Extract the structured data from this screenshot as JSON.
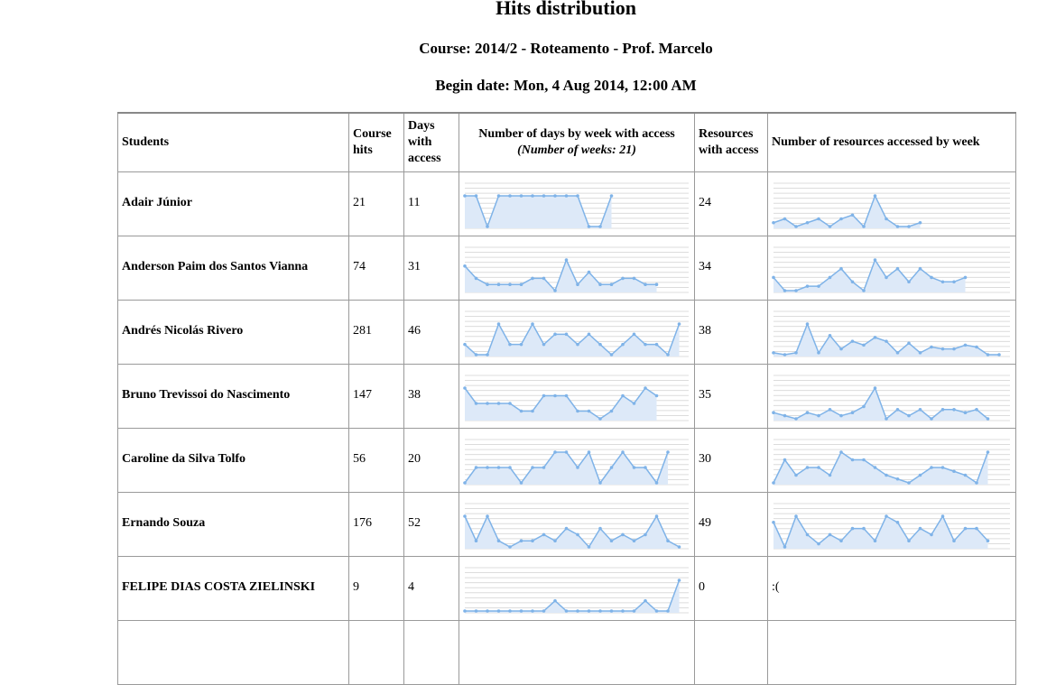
{
  "report": {
    "title": "Hits distribution",
    "course": "Course: 2014/2 - Roteamento - Prof. Marcelo",
    "begin_date": "Begin date: Mon, 4 Aug 2014, 12:00 AM"
  },
  "table": {
    "headers": {
      "students": "Students",
      "course_hits": "Course hits",
      "days_with_access": "Days with access",
      "days_by_week": "Number of days by week with access",
      "weeks_note": "(Number of weeks: 21)",
      "resources_with_access": "Resources with access",
      "resources_by_week": "Number of resources accessed by week"
    },
    "rows": [
      {
        "name": "Adair Júnior",
        "hits": "21",
        "days": "11",
        "days_week": [
          1,
          1,
          0,
          1,
          1,
          1,
          1,
          1,
          1,
          1,
          1,
          0,
          0,
          1
        ],
        "resources": "24",
        "res_week": [
          1,
          2,
          0,
          1,
          2,
          0,
          2,
          3,
          0,
          8,
          2,
          0,
          0,
          1
        ],
        "res_text": ""
      },
      {
        "name": "Anderson Paim dos Santos Vianna",
        "hits": "74",
        "days": "31",
        "days_week": [
          3,
          1,
          0,
          0,
          0,
          0,
          1,
          1,
          -1,
          4,
          0,
          2,
          0,
          0,
          1,
          1,
          0,
          0
        ],
        "resources": "34",
        "res_week": [
          3,
          0,
          0,
          1,
          1,
          3,
          5,
          2,
          0,
          7,
          3,
          5,
          2,
          5,
          3,
          2,
          2,
          3
        ],
        "res_text": ""
      },
      {
        "name": "Andrés Nicolás Rivero",
        "hits": "281",
        "days": "46",
        "days_week": [
          1,
          0,
          0,
          3,
          1,
          1,
          3,
          1,
          2,
          2,
          1,
          2,
          1,
          0,
          1,
          2,
          1,
          1,
          0,
          3
        ],
        "resources": "38",
        "res_week": [
          1,
          0,
          1,
          16,
          1,
          10,
          3,
          7,
          5,
          9,
          7,
          1,
          6,
          1,
          4,
          3,
          3,
          5,
          4,
          0,
          0
        ],
        "res_text": ""
      },
      {
        "name": "Bruno Trevissoi do Nascimento",
        "hits": "147",
        "days": "38",
        "days_week": [
          3,
          1,
          1,
          1,
          1,
          0,
          0,
          2,
          2,
          2,
          0,
          0,
          -1,
          0,
          2,
          1,
          3,
          2
        ],
        "resources": "35",
        "res_week": [
          2,
          1,
          0,
          2,
          1,
          3,
          1,
          2,
          4,
          10,
          0,
          3,
          1,
          3,
          0,
          3,
          3,
          2,
          3,
          0
        ],
        "res_text": ""
      },
      {
        "name": "Caroline da Silva Tolfo",
        "hits": "56",
        "days": "20",
        "days_week": [
          0,
          1,
          1,
          1,
          1,
          0,
          1,
          1,
          2,
          2,
          1,
          2,
          0,
          1,
          2,
          1,
          1,
          0,
          2
        ],
        "resources": "30",
        "res_week": [
          0,
          3,
          1,
          2,
          2,
          1,
          4,
          3,
          3,
          2,
          1,
          0.5,
          0,
          1,
          2,
          2,
          1.5,
          1,
          0,
          4
        ],
        "res_text": ""
      },
      {
        "name": "Ernando Souza",
        "hits": "176",
        "days": "52",
        "days_week": [
          5,
          1,
          5,
          1,
          0,
          1,
          1,
          2,
          1,
          3,
          2,
          0,
          3,
          1,
          2,
          1,
          2,
          5,
          1,
          0
        ],
        "resources": "49",
        "res_week": [
          3,
          -1,
          4,
          1,
          -0.5,
          1,
          0,
          2,
          2,
          0,
          4,
          3,
          0,
          2,
          1,
          4,
          0,
          2,
          2,
          0
        ],
        "res_text": ""
      },
      {
        "name": "FELIPE DIAS COSTA ZIELINSKI",
        "hits": "9",
        "days": "4",
        "days_week": [
          0,
          0,
          0,
          0,
          0,
          0,
          0,
          0,
          1,
          0,
          0,
          0,
          0,
          0,
          0,
          0,
          1,
          0,
          0,
          3
        ],
        "resources": "0",
        "res_week": [],
        "res_text": ":("
      }
    ]
  },
  "colors": {
    "spark_line": "#7fb3e8",
    "spark_fill": "#dde9f8",
    "grid": "#dcdcdc"
  }
}
